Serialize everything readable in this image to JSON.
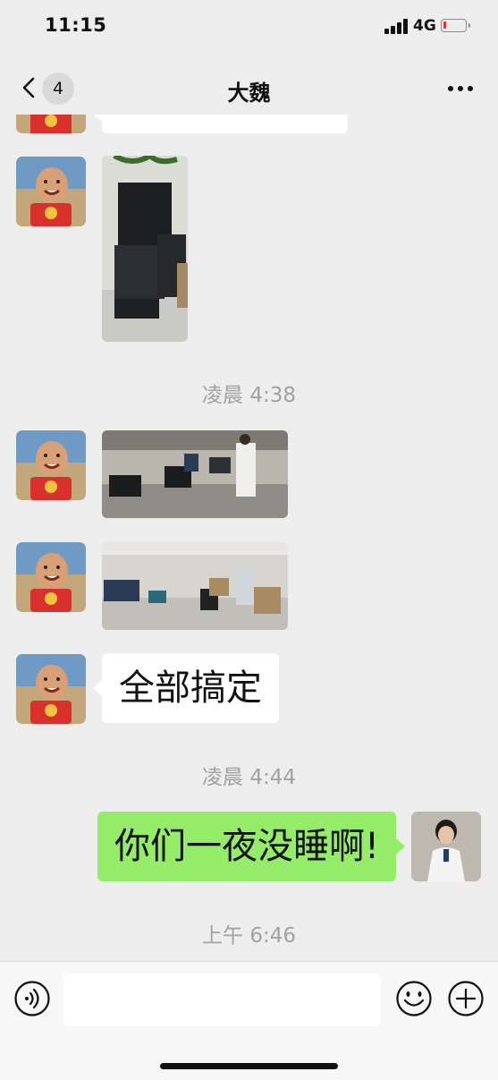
{
  "status_bar": {
    "time": "11:15",
    "network": "4G",
    "battery_level_fraction": 0.05
  },
  "header": {
    "back_badge": "4",
    "title": "大魏"
  },
  "messages": {
    "ts1": "凌晨 4:38",
    "text1": "全部搞定",
    "ts2": "凌晨 4:44",
    "text2": "你们一夜没睡啊!",
    "ts3": "上午 6:46"
  },
  "icons": {
    "back": "chevron-left-icon",
    "more": "ellipsis-icon",
    "voice": "voice-icon",
    "emoji": "emoji-icon",
    "plus": "plus-icon"
  },
  "colors": {
    "background": "#ededed",
    "sent_bubble": "#95ec69",
    "received_bubble": "#ffffff",
    "timestamp": "#a1a1a1"
  }
}
